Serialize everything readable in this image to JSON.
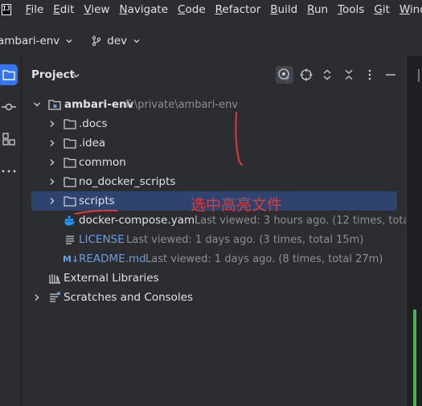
{
  "menubar": {
    "items": [
      {
        "first": "F",
        "rest": "ile"
      },
      {
        "first": "E",
        "rest": "dit"
      },
      {
        "first": "V",
        "rest": "iew"
      },
      {
        "first": "N",
        "rest": "avigate"
      },
      {
        "first": "C",
        "rest": "ode"
      },
      {
        "first": "R",
        "rest": "efactor"
      },
      {
        "first": "B",
        "rest": "uild"
      },
      {
        "first": "R",
        "rest": "un"
      },
      {
        "first": "T",
        "rest": "ools"
      },
      {
        "first": "G",
        "rest": "it"
      },
      {
        "first": "W",
        "rest": "indo"
      }
    ],
    "logo_text": "IJ"
  },
  "toolbar": {
    "project_name": "ambari-env",
    "branch_name": "dev"
  },
  "panel": {
    "title": "Project"
  },
  "tree": {
    "root": {
      "label": "ambari-env",
      "path": "F:\\private\\ambari-env"
    },
    "folders": [
      ".docs",
      ".idea",
      "common",
      "no_docker_scripts",
      "scripts"
    ],
    "files": [
      {
        "label": "docker-compose.yaml",
        "meta": "Last viewed: 3 hours ago. (12 times, total"
      },
      {
        "label": "LICENSE",
        "meta": "Last viewed: 1 days ago. (3 times, total 15m)"
      },
      {
        "label": "README.md",
        "meta": "Last viewed: 1 days ago. (8 times, total 27m)",
        "icon_text": "M↓"
      }
    ],
    "external_libraries": "External Libraries",
    "scratches": "Scratches and Consoles"
  },
  "annotation": {
    "text": "选中高亮文件"
  },
  "colors": {
    "selection": "#2e436e",
    "accent": "#3574f0",
    "annotation": "#e53935",
    "link_blue": "#6a9be5"
  }
}
